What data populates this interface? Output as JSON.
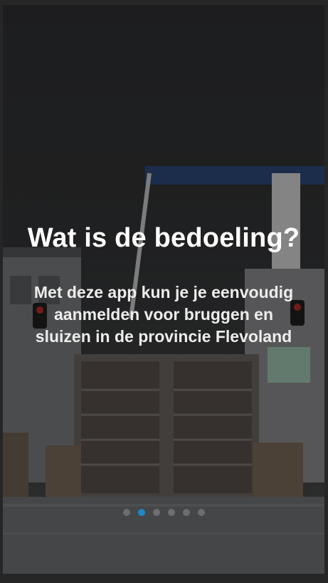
{
  "intro": {
    "title": "Wat is de bedoeling?",
    "body_line1": "Met deze app kun je je eenvoudig",
    "body_line2": "aanmelden voor bruggen en",
    "body_line3": "sluizen in de provincie Flevoland"
  },
  "pager": {
    "total_pages": 6,
    "active_page": 2
  },
  "colors": {
    "indicator_active": "#1e88c7",
    "indicator_inactive": "#6e6e70",
    "title_text": "#ffffff"
  },
  "background": {
    "image": "sluice-lock-photo"
  }
}
